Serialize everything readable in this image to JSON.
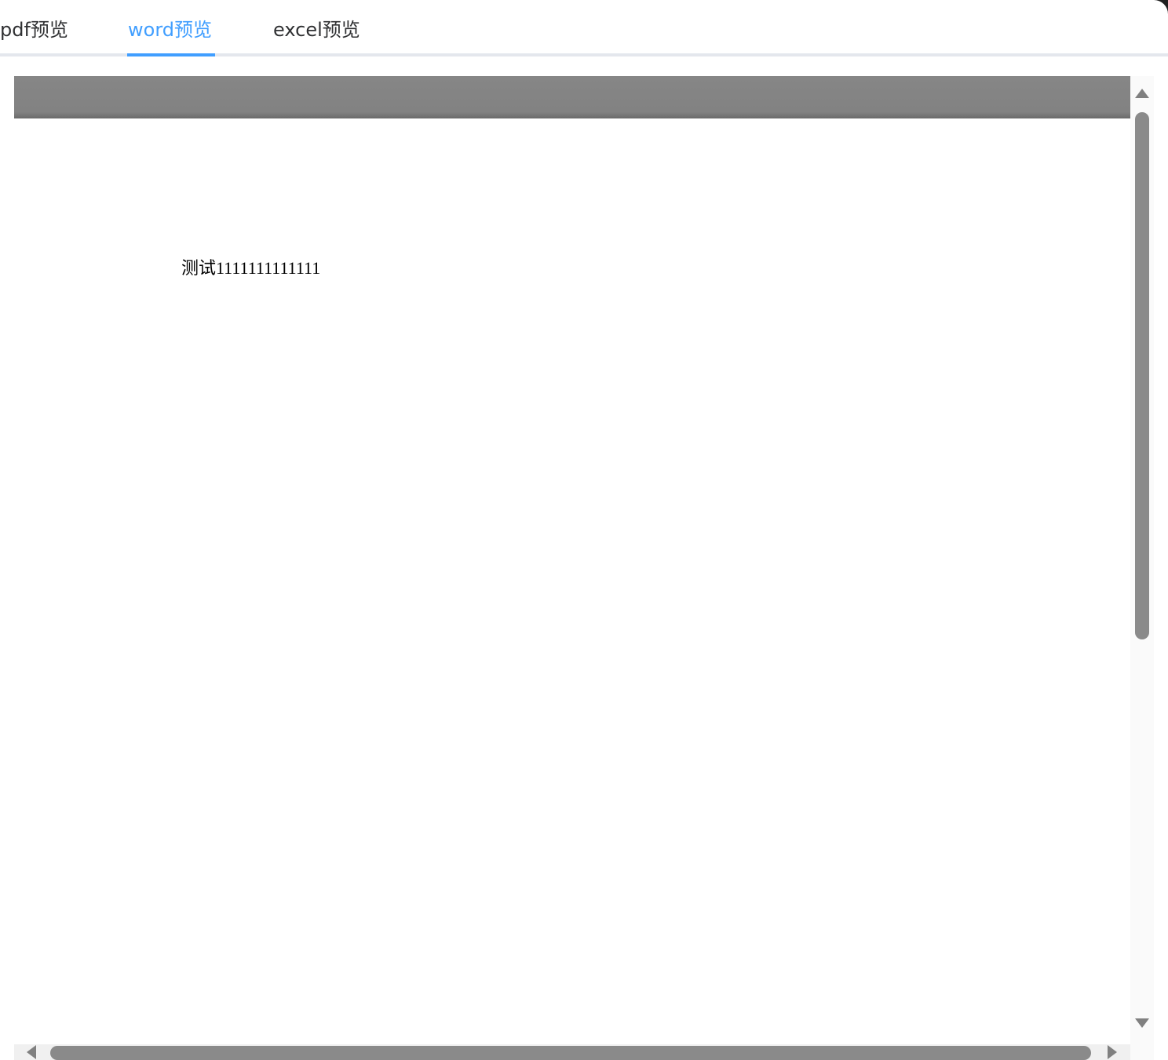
{
  "tabs": [
    {
      "label": "pdf预览",
      "active": false
    },
    {
      "label": "word预览",
      "active": true
    },
    {
      "label": "excel预览",
      "active": false
    }
  ],
  "document": {
    "text": "测试1111111111111"
  },
  "icons": {
    "scroll_up": "triangle-up-icon",
    "scroll_down": "triangle-down-icon",
    "scroll_left": "triangle-left-icon",
    "scroll_right": "triangle-right-icon"
  },
  "colors": {
    "accent": "#409eff",
    "tab_text": "#303133",
    "tab_divider": "#e4e7ed",
    "toolbar": "#828282",
    "scroll_thumb": "#8a8a8a"
  }
}
